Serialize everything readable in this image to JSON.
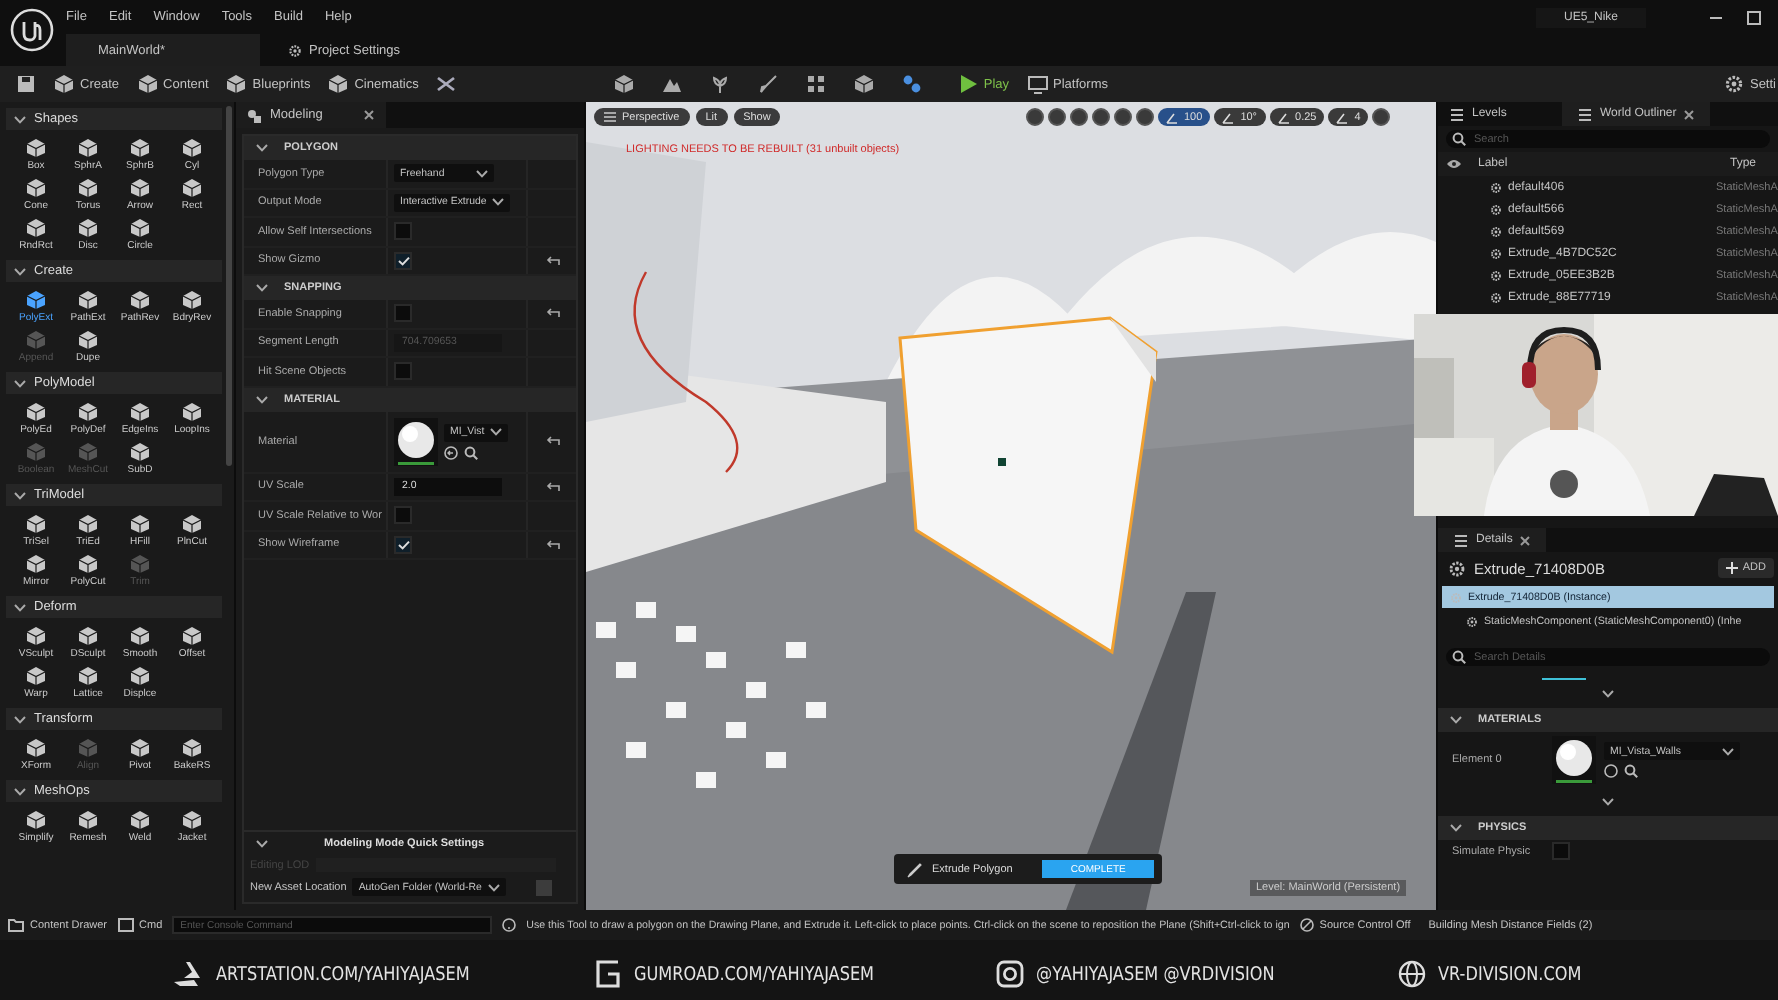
{
  "menu_bar": {
    "items": [
      "File",
      "Edit",
      "Window",
      "Tools",
      "Build",
      "Help"
    ],
    "project": "UE5_Nike"
  },
  "document_tabs": [
    {
      "label": "MainWorld*",
      "selected": true
    },
    {
      "label": "Project Settings",
      "selected": false
    }
  ],
  "toolbar": {
    "buttons": [
      "Create",
      "Content",
      "Blueprints",
      "Cinematics"
    ],
    "play": "Play",
    "platforms": "Platforms",
    "settings": "Setti"
  },
  "tool_palette": [
    {
      "category": "Shapes",
      "tools": [
        {
          "label": "Box",
          "selected": false,
          "disabled": false
        },
        {
          "label": "SphrA",
          "selected": false,
          "disabled": false
        },
        {
          "label": "SphrB",
          "selected": false,
          "disabled": false
        },
        {
          "label": "Cyl",
          "selected": false,
          "disabled": false
        },
        {
          "label": "Cone",
          "selected": false,
          "disabled": false
        },
        {
          "label": "Torus",
          "selected": false,
          "disabled": false
        },
        {
          "label": "Arrow",
          "selected": false,
          "disabled": false
        },
        {
          "label": "Rect",
          "selected": false,
          "disabled": false
        },
        {
          "label": "RndRct",
          "selected": false,
          "disabled": false
        },
        {
          "label": "Disc",
          "selected": false,
          "disabled": false
        },
        {
          "label": "Circle",
          "selected": false,
          "disabled": false
        }
      ]
    },
    {
      "category": "Create",
      "tools": [
        {
          "label": "PolyExt",
          "selected": true,
          "disabled": false
        },
        {
          "label": "PathExt",
          "selected": false,
          "disabled": false
        },
        {
          "label": "PathRev",
          "selected": false,
          "disabled": false
        },
        {
          "label": "BdryRev",
          "selected": false,
          "disabled": false
        },
        {
          "label": "Append",
          "selected": false,
          "disabled": true
        },
        {
          "label": "Dupe",
          "selected": false,
          "disabled": false
        }
      ]
    },
    {
      "category": "PolyModel",
      "tools": [
        {
          "label": "PolyEd",
          "selected": false,
          "disabled": false
        },
        {
          "label": "PolyDef",
          "selected": false,
          "disabled": false
        },
        {
          "label": "EdgeIns",
          "selected": false,
          "disabled": false
        },
        {
          "label": "LoopIns",
          "selected": false,
          "disabled": false
        },
        {
          "label": "Boolean",
          "selected": false,
          "disabled": true
        },
        {
          "label": "MeshCut",
          "selected": false,
          "disabled": true
        },
        {
          "label": "SubD",
          "selected": false,
          "disabled": false
        }
      ]
    },
    {
      "category": "TriModel",
      "tools": [
        {
          "label": "TriSel",
          "selected": false,
          "disabled": false
        },
        {
          "label": "TriEd",
          "selected": false,
          "disabled": false
        },
        {
          "label": "HFill",
          "selected": false,
          "disabled": false
        },
        {
          "label": "PlnCut",
          "selected": false,
          "disabled": false
        },
        {
          "label": "Mirror",
          "selected": false,
          "disabled": false
        },
        {
          "label": "PolyCut",
          "selected": false,
          "disabled": false
        },
        {
          "label": "Trim",
          "selected": false,
          "disabled": true
        }
      ]
    },
    {
      "category": "Deform",
      "tools": [
        {
          "label": "VSculpt",
          "selected": false,
          "disabled": false
        },
        {
          "label": "DSculpt",
          "selected": false,
          "disabled": false
        },
        {
          "label": "Smooth",
          "selected": false,
          "disabled": false
        },
        {
          "label": "Offset",
          "selected": false,
          "disabled": false
        },
        {
          "label": "Warp",
          "selected": false,
          "disabled": false
        },
        {
          "label": "Lattice",
          "selected": false,
          "disabled": false
        },
        {
          "label": "Displce",
          "selected": false,
          "disabled": false
        }
      ]
    },
    {
      "category": "Transform",
      "tools": [
        {
          "label": "XForm",
          "selected": false,
          "disabled": false
        },
        {
          "label": "Align",
          "selected": false,
          "disabled": true
        },
        {
          "label": "Pivot",
          "selected": false,
          "disabled": false
        },
        {
          "label": "BakeRS",
          "selected": false,
          "disabled": false
        }
      ]
    },
    {
      "category": "MeshOps",
      "tools": [
        {
          "label": "Simplify",
          "selected": false,
          "disabled": false
        },
        {
          "label": "Remesh",
          "selected": false,
          "disabled": false
        },
        {
          "label": "Weld",
          "selected": false,
          "disabled": false
        },
        {
          "label": "Jacket",
          "selected": false,
          "disabled": false
        }
      ]
    }
  ],
  "modeling_panel": {
    "tab": "Modeling",
    "sections": [
      {
        "title": "POLYGON",
        "rows": [
          {
            "kind": "dropdown",
            "label": "Polygon Type",
            "value": "Freehand",
            "reset": false
          },
          {
            "kind": "dropdown",
            "label": "Output Mode",
            "value": "Interactive Extrude",
            "reset": false
          },
          {
            "kind": "checkbox",
            "label": "Allow Self Intersections",
            "checked": false,
            "reset": false
          },
          {
            "kind": "checkbox",
            "label": "Show Gizmo",
            "checked": true,
            "reset": true
          }
        ]
      },
      {
        "title": "SNAPPING",
        "rows": [
          {
            "kind": "checkbox",
            "label": "Enable Snapping",
            "checked": false,
            "reset": true
          },
          {
            "kind": "number",
            "label": "Segment Length",
            "value": "704.709653",
            "disabled": true,
            "reset": false
          },
          {
            "kind": "checkbox",
            "label": "Hit Scene Objects",
            "checked": false,
            "reset": false
          }
        ]
      },
      {
        "title": "MATERIAL",
        "rows": [
          {
            "kind": "material",
            "label": "Material",
            "value": "MI_Vist",
            "reset": true
          },
          {
            "kind": "number",
            "label": "UV Scale",
            "value": "2.0",
            "disabled": false,
            "reset": true
          },
          {
            "kind": "checkbox",
            "label": "UV Scale Relative to Wor",
            "checked": false,
            "reset": false
          },
          {
            "kind": "checkbox",
            "label": "Show Wireframe",
            "checked": true,
            "reset": true
          }
        ]
      }
    ],
    "quick_settings": {
      "title": "Modeling Mode Quick Settings",
      "editing_lod": "Editing LOD",
      "asset_location_label": "New Asset Location",
      "asset_location": "AutoGen Folder (World-Re",
      "asset_option_checked": false
    }
  },
  "viewport": {
    "view_buttons": [
      "Perspective",
      "Lit",
      "Show"
    ],
    "warning": "LIGHTING NEEDS TO BE REBUILT (31 unbuilt objects)",
    "snap_values": [
      "100",
      "10°",
      "0.25",
      "4"
    ],
    "tool_prompt": {
      "label": "Extrude Polygon",
      "action": "COMPLETE"
    },
    "level": "Level:  MainWorld (Persistent)"
  },
  "outliner": {
    "tabs": [
      {
        "label": "Levels",
        "selected": false
      },
      {
        "label": "World Outliner",
        "selected": true
      }
    ],
    "search_placeholder": "Search",
    "columns": [
      "Label",
      "Type"
    ],
    "rows": [
      {
        "label": "default406",
        "type": "StaticMeshA"
      },
      {
        "label": "default566",
        "type": "StaticMeshA"
      },
      {
        "label": "default569",
        "type": "StaticMeshA"
      },
      {
        "label": "Extrude_4B7DC52C",
        "type": "StaticMeshA"
      },
      {
        "label": "Extrude_05EE3B2B",
        "type": "StaticMeshA"
      },
      {
        "label": "Extrude_88E77719",
        "type": "StaticMeshA"
      }
    ]
  },
  "details": {
    "tab": "Details",
    "actor": "Extrude_71408D0B",
    "add": "ADD",
    "tree": [
      {
        "label": "Extrude_71408D0B (Instance)",
        "selected": true
      },
      {
        "label": "StaticMeshComponent (StaticMeshComponent0) (Inhe",
        "selected": false
      }
    ],
    "search_placeholder": "Search Details",
    "materials_title": "MATERIALS",
    "element_label": "Element 0",
    "material": "MI_Vista_Walls",
    "physics_title": "PHYSICS",
    "physics_row": "Simulate Physic",
    "simulate_checked": false
  },
  "status_bar": {
    "content_drawer": "Content Drawer",
    "cmd": "Cmd",
    "console_placeholder": "Enter Console Command",
    "hint": "Use this Tool to draw a polygon on the Drawing Plane, and Extrude it. Left-click to place points. Ctrl-click on the scene to reposition the Plane (Shift+Ctrl-click to ign",
    "source_control": "Source Control Off",
    "progress": "Building Mesh Distance Fields (2)"
  },
  "footer": [
    {
      "kind": "artstation",
      "text": "ARTSTATION.COM/YAHIYAJASEM"
    },
    {
      "kind": "gumroad",
      "text": "GUMROAD.COM/YAHIYAJASEM"
    },
    {
      "kind": "instagram",
      "text": "@YAHIYAJASEM @VRDIVISION"
    },
    {
      "kind": "web",
      "text": "VR-DIVISION.COM"
    }
  ]
}
